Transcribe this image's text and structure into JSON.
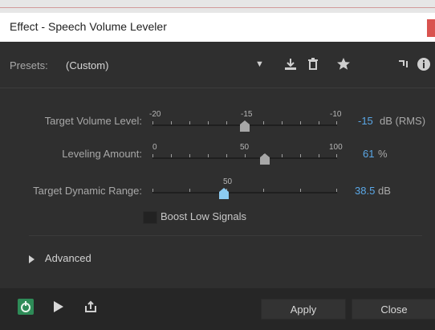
{
  "window": {
    "title": "Effect - Speech Volume Leveler"
  },
  "toolbar": {
    "presets_label": "Presets:",
    "presets_value": "(Custom)",
    "icons": [
      "chevron-down-icon",
      "download-icon",
      "trash-icon",
      "star-icon",
      "routing-icon",
      "info-icon"
    ]
  },
  "params": {
    "target_volume": {
      "label": "Target Volume Level:",
      "scale_labels": [
        "-20",
        "-15",
        "-10"
      ],
      "min": -20,
      "max": -10,
      "value": -15,
      "value_text": "-15",
      "unit": "dB (RMS)"
    },
    "leveling_amount": {
      "label": "Leveling Amount:",
      "scale_labels": [
        "0",
        "50",
        "100"
      ],
      "min": 0,
      "max": 100,
      "value": 61,
      "value_text": "61",
      "unit": "%"
    },
    "dynamic_range": {
      "label": "Target Dynamic Range:",
      "scale_labels": [
        "50"
      ],
      "min": 0,
      "max": 100,
      "value": 38.5,
      "value_text": "38.5",
      "unit": "dB"
    }
  },
  "checkbox": {
    "label": "Boost Low Signals",
    "checked": false
  },
  "advanced": {
    "label": "Advanced"
  },
  "footer": {
    "apply_label": "Apply",
    "close_label": "Close",
    "icons": [
      "power-icon",
      "play-icon",
      "export-icon"
    ],
    "power_color": "#2e8b57"
  },
  "colors": {
    "value_blue": "#5aa7e6",
    "thumb_blue": "#8ccbf0",
    "thumb_gray": "#a7a7a7"
  }
}
